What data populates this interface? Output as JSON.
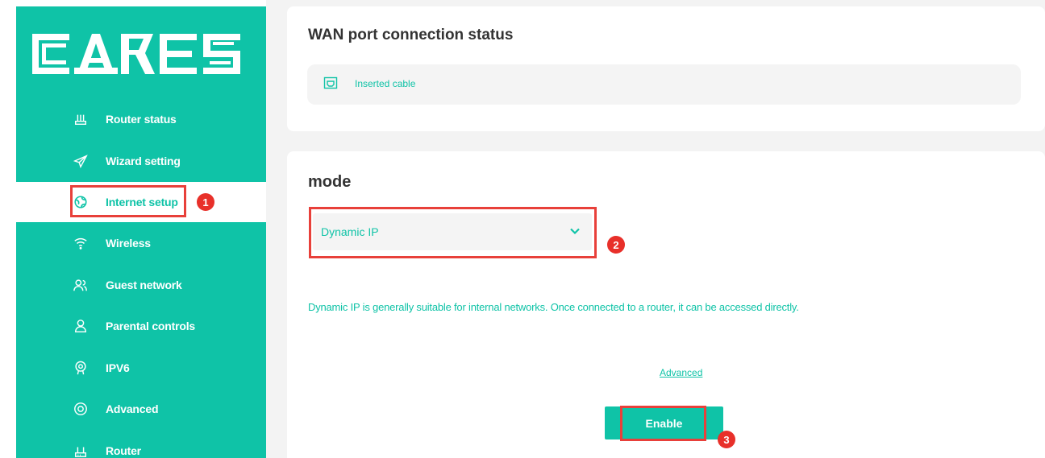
{
  "sidebar": {
    "logo_text": "CARES",
    "items": [
      {
        "label": "Router status",
        "icon": "router-icon"
      },
      {
        "label": "Wizard setting",
        "icon": "send-icon"
      },
      {
        "label": "Internet setup",
        "icon": "globe-icon"
      },
      {
        "label": "Wireless",
        "icon": "wifi-icon"
      },
      {
        "label": "Guest network",
        "icon": "users-icon"
      },
      {
        "label": "Parental controls",
        "icon": "parent-icon"
      },
      {
        "label": "IPV6",
        "icon": "ipv6-icon"
      },
      {
        "label": "Advanced",
        "icon": "target-icon"
      },
      {
        "label": "Router",
        "icon": "router-icon"
      }
    ],
    "active_index": 2
  },
  "wan": {
    "title": "WAN port connection status",
    "status_text": "Inserted cable",
    "status_icon": "ethernet-port-icon"
  },
  "mode": {
    "title": "mode",
    "selected": "Dynamic IP",
    "description": "Dynamic IP is generally suitable for internal networks. Once connected to a router, it can be accessed directly.",
    "advanced_label": "Advanced",
    "enable_label": "Enable"
  },
  "annotations": {
    "step1": "1",
    "step2": "2",
    "step3": "3"
  },
  "colors": {
    "accent": "#0fc3a7",
    "highlight": "#e8403a",
    "badge": "#e8302a"
  }
}
